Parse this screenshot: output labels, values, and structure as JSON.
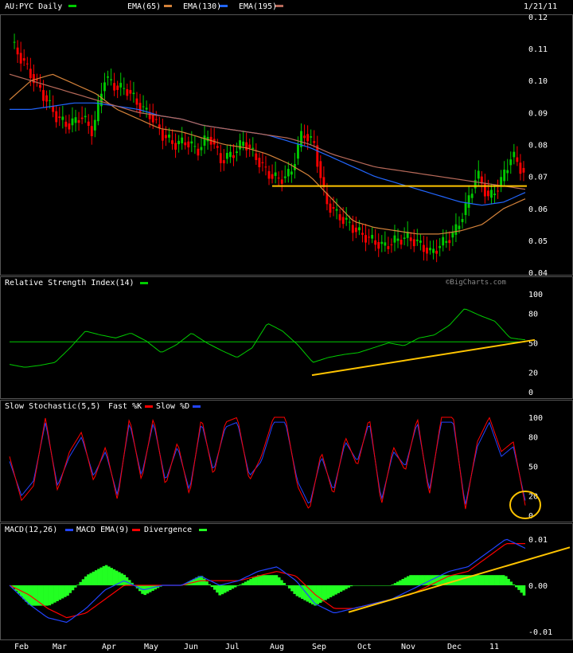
{
  "header": {
    "title": "AU:PYC Daily",
    "date": "1/21/11",
    "ema_labels": [
      "EMA(65)",
      "EMA(130)",
      "EMA(195)"
    ],
    "watermark": "©BigCharts.com"
  },
  "colors": {
    "background": "#000000",
    "up": "#00cc00",
    "down": "#ff0000",
    "ema65": "#d4823a",
    "ema130": "#2266ff",
    "ema195": "#b86a5a",
    "annotation": "#ffc400",
    "rsi": "#00cc00",
    "fast_k": "#ff0000",
    "slow_d": "#2244ff",
    "macd": "#2244ff",
    "macd_ema": "#ff0000",
    "divergence": "#22ff22"
  },
  "chart_data": [
    {
      "type": "candlestick",
      "title": "AU:PYC Daily",
      "x_tick_labels": [
        "Feb",
        "Mar",
        "Apr",
        "May",
        "Jun",
        "Jul",
        "Aug",
        "Sep",
        "Oct",
        "Nov",
        "Dec",
        "11"
      ],
      "y_tick_labels": [
        "0.12",
        "0.11",
        "0.10",
        "0.09",
        "0.08",
        "0.07",
        "0.06",
        "0.05",
        "0.04"
      ],
      "ylim": [
        0.04,
        0.12
      ],
      "series": [
        {
          "name": "EMA(65)",
          "values": [
            0.094,
            0.1,
            0.102,
            0.099,
            0.096,
            0.091,
            0.088,
            0.085,
            0.084,
            0.082,
            0.08,
            0.079,
            0.077,
            0.074,
            0.07,
            0.063,
            0.056,
            0.054,
            0.053,
            0.052,
            0.052,
            0.053,
            0.055,
            0.06,
            0.063
          ]
        },
        {
          "name": "EMA(130)",
          "values": [
            0.091,
            0.091,
            0.092,
            0.093,
            0.093,
            0.092,
            0.091,
            0.089,
            0.088,
            0.086,
            0.085,
            0.084,
            0.083,
            0.081,
            0.079,
            0.076,
            0.073,
            0.07,
            0.068,
            0.066,
            0.064,
            0.062,
            0.061,
            0.062,
            0.065
          ]
        },
        {
          "name": "EMA(195)",
          "values": [
            0.102,
            0.1,
            0.098,
            0.096,
            0.094,
            0.092,
            0.09,
            0.089,
            0.088,
            0.086,
            0.085,
            0.084,
            0.083,
            0.082,
            0.08,
            0.077,
            0.075,
            0.073,
            0.072,
            0.071,
            0.07,
            0.069,
            0.068,
            0.067,
            0.066
          ]
        }
      ],
      "price_path": [
        0.112,
        0.106,
        0.1,
        0.094,
        0.088,
        0.086,
        0.089,
        0.084,
        0.101,
        0.098,
        0.097,
        0.092,
        0.089,
        0.083,
        0.08,
        0.081,
        0.078,
        0.083,
        0.075,
        0.077,
        0.081,
        0.076,
        0.071,
        0.069,
        0.071,
        0.084,
        0.08,
        0.062,
        0.058,
        0.055,
        0.052,
        0.05,
        0.048,
        0.05,
        0.051,
        0.049,
        0.046,
        0.049,
        0.052,
        0.06,
        0.071,
        0.063,
        0.068,
        0.077,
        0.071
      ]
    },
    {
      "type": "line",
      "title": "Relative Strength Index(14)",
      "y_tick_labels": [
        "100",
        "80",
        "50",
        "20",
        "0"
      ],
      "ylim": [
        0,
        100
      ],
      "values": [
        28,
        25,
        27,
        30,
        45,
        62,
        58,
        55,
        60,
        52,
        40,
        48,
        60,
        50,
        42,
        35,
        45,
        70,
        62,
        48,
        30,
        35,
        38,
        40,
        45,
        50,
        47,
        55,
        58,
        68,
        85,
        78,
        72,
        55,
        53
      ],
      "reference": 51
    },
    {
      "type": "line",
      "title": "Slow Stochastic(5,5)",
      "legend": [
        "Fast %K",
        "Slow %D"
      ],
      "y_tick_labels": [
        "100",
        "80",
        "50",
        "20",
        "0"
      ],
      "ylim": [
        0,
        100
      ],
      "fast_k": [
        60,
        15,
        30,
        100,
        25,
        65,
        85,
        35,
        70,
        15,
        100,
        35,
        100,
        30,
        75,
        20,
        100,
        40,
        95,
        100,
        35,
        60,
        100,
        100,
        30,
        5,
        65,
        20,
        80,
        50,
        100,
        10,
        70,
        45,
        100,
        20,
        100,
        100,
        5,
        75,
        100,
        65,
        75,
        10
      ],
      "slow_d": [
        55,
        20,
        35,
        95,
        30,
        60,
        80,
        40,
        65,
        20,
        95,
        40,
        95,
        35,
        70,
        25,
        95,
        45,
        90,
        95,
        40,
        55,
        95,
        95,
        35,
        10,
        60,
        25,
        75,
        55,
        95,
        15,
        65,
        50,
        95,
        25,
        95,
        95,
        10,
        70,
        95,
        60,
        70,
        15
      ]
    },
    {
      "type": "line",
      "title": "MACD(12,26)",
      "legend": [
        "MACD EMA(9)",
        "Divergence"
      ],
      "y_tick_labels": [
        "0.01",
        "0.00",
        "-0.01"
      ],
      "ylim": [
        -0.011,
        0.011
      ],
      "macd": [
        0.0,
        -0.004,
        -0.007,
        -0.008,
        -0.005,
        -0.001,
        0.001,
        -0.001,
        0.0,
        0.0,
        0.002,
        0.0,
        0.001,
        0.003,
        0.004,
        0.001,
        -0.004,
        -0.006,
        -0.005,
        -0.004,
        -0.003,
        -0.001,
        0.001,
        0.003,
        0.004,
        0.007,
        0.01,
        0.008
      ],
      "ema": [
        0.0,
        -0.002,
        -0.005,
        -0.007,
        -0.006,
        -0.003,
        0.0,
        0.0,
        0.0,
        0.0,
        0.001,
        0.001,
        0.001,
        0.002,
        0.003,
        0.002,
        -0.002,
        -0.005,
        -0.005,
        -0.004,
        -0.003,
        -0.002,
        0.0,
        0.002,
        0.003,
        0.006,
        0.009,
        0.009
      ]
    }
  ]
}
